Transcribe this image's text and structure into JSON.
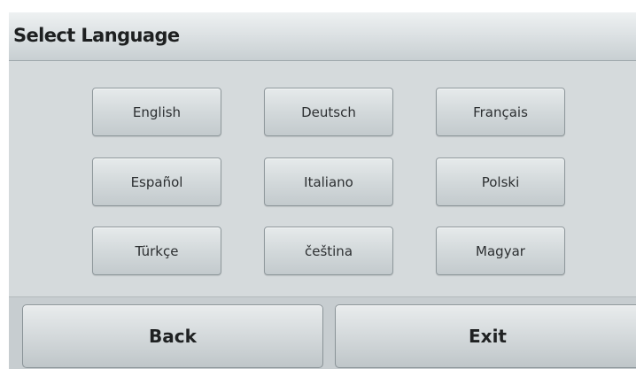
{
  "header": {
    "title": "Select Language"
  },
  "languages": [
    {
      "label": "English"
    },
    {
      "label": "Deutsch"
    },
    {
      "label": "Français"
    },
    {
      "label": "Español"
    },
    {
      "label": "Italiano"
    },
    {
      "label": "Polski"
    },
    {
      "label": "Türkçe"
    },
    {
      "label": "čeština"
    },
    {
      "label": "Magyar"
    }
  ],
  "footer": {
    "back_label": "Back",
    "exit_label": "Exit"
  }
}
